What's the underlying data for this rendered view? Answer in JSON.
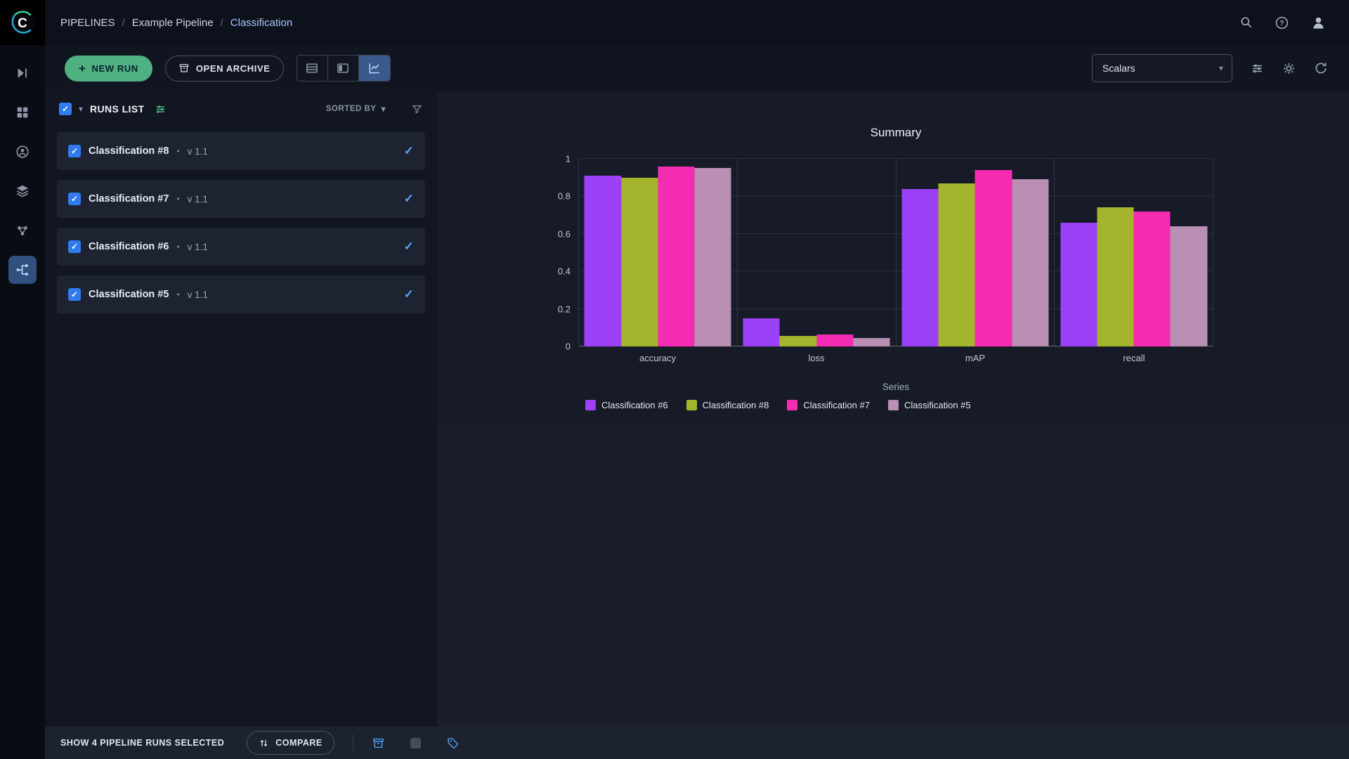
{
  "header": {
    "breadcrumb": {
      "section": "PIPELINES",
      "separator": "/",
      "project": "Example Pipeline",
      "current": "Classification"
    }
  },
  "toolbar": {
    "new_run_label": "NEW RUN",
    "open_archive_label": "OPEN ARCHIVE",
    "metric_select_value": "Scalars"
  },
  "runs_panel": {
    "title": "RUNS LIST",
    "sorted_by_label": "SORTED BY",
    "runs": [
      {
        "name": "Classification #8",
        "version": "v 1.1",
        "checked": true,
        "selected": true
      },
      {
        "name": "Classification #7",
        "version": "v 1.1",
        "checked": true,
        "selected": true
      },
      {
        "name": "Classification #6",
        "version": "v 1.1",
        "checked": true,
        "selected": true
      },
      {
        "name": "Classification #5",
        "version": "v 1.1",
        "checked": true,
        "selected": true
      }
    ]
  },
  "chart_data": {
    "type": "bar",
    "title": "Summary",
    "categories": [
      "accuracy",
      "loss",
      "mAP",
      "recall"
    ],
    "series": [
      {
        "name": "Classification #6",
        "color": "#9d41f8",
        "values": [
          0.91,
          0.15,
          0.84,
          0.66
        ]
      },
      {
        "name": "Classification #8",
        "color": "#a4b42d",
        "values": [
          0.9,
          0.055,
          0.87,
          0.74
        ]
      },
      {
        "name": "Classification #7",
        "color": "#f42cb2",
        "values": [
          0.96,
          0.065,
          0.94,
          0.72
        ]
      },
      {
        "name": "Classification #5",
        "color": "#b98fb4",
        "values": [
          0.95,
          0.045,
          0.89,
          0.64
        ]
      }
    ],
    "legend_title": "Series",
    "xlabel": "",
    "ylabel": "",
    "ylim": [
      0,
      1
    ],
    "yticks": [
      0,
      0.2,
      0.4,
      0.6,
      0.8,
      1
    ],
    "grid": true,
    "legend_position": "bottom"
  },
  "footer": {
    "selection_label": "SHOW 4 PIPELINE RUNS SELECTED",
    "compare_label": "COMPARE"
  },
  "icons": {
    "plus": "+",
    "check": "✓",
    "caret_down": "▾",
    "bullet": "•"
  },
  "colors": {
    "accent_blue": "#3f85f5",
    "accent_green": "#4fb181",
    "selected_check": "#55a6ff",
    "active_nav": "#30517e"
  }
}
